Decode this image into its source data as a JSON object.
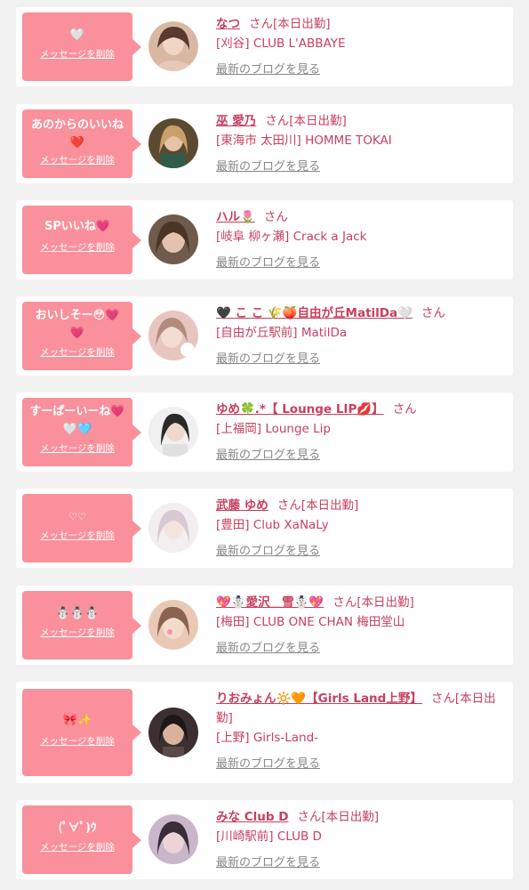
{
  "delete_label": "メッセージを削除",
  "blog_label": "最新のブログを見る",
  "san_suffix": "さん",
  "accent_color": "#f9909b",
  "name_color": "#c83f5e",
  "cards": [
    {
      "message": "🤍",
      "name": "なつ",
      "suffix": "さん[本日出勤]",
      "shop": "[刈谷] CLUB L'ABBAYE",
      "avatar_colors": [
        "#d9b8a3",
        "#5a3a2e"
      ]
    },
    {
      "message": "あのからのいいね\n❤️",
      "name": "巫 愛乃",
      "suffix": "さん[本日出勤]",
      "shop": "[東海市 太田川] HOMME TOKAI",
      "avatar_colors": [
        "#5b4a32",
        "#caa06a"
      ]
    },
    {
      "message": "SPいいね💗",
      "name": "ハル🌷",
      "suffix": "さん",
      "shop": "[岐阜 柳ヶ瀬] Crack a Jack",
      "avatar_colors": [
        "#6f5a4c",
        "#e3c3b0"
      ]
    },
    {
      "message": "おいしそー😳💗\n💗",
      "name": "🖤 こ こ 🌾🍑自由が丘MatilDa🤍",
      "suffix": "さん",
      "shop": "[自由が丘駅前] MatilDa",
      "avatar_colors": [
        "#e8c5bf",
        "#b28b7c"
      ]
    },
    {
      "message": "すーぱーいーね💗\n🤍🩵",
      "name": "ゆめ🍀.*【 Lounge LIP💋】",
      "suffix": "さん",
      "shop": "[上福岡] Lounge Lip",
      "avatar_colors": [
        "#f0f0f0",
        "#2a2a2a"
      ]
    },
    {
      "message": "♡♡",
      "name": "武藤 ゆめ",
      "suffix": "さん[本日出勤]",
      "shop": "[豊田] Club XaNaLy",
      "avatar_colors": [
        "#f3eef0",
        "#d8c9d4"
      ]
    },
    {
      "message": "☃️☃️☃️",
      "name": "💖☃️愛沢＿雪☃️💖",
      "suffix": "さん[本日出勤]",
      "shop": "[梅田] CLUB ONE CHAN 梅田堂山",
      "avatar_colors": [
        "#e9c9b6",
        "#8a6450"
      ]
    },
    {
      "message": "🎀✨",
      "name": "りおみょん🔆🧡【Girls Land上野】",
      "suffix": "さん[本日出勤]",
      "shop": "[上野] Girls-Land-",
      "avatar_colors": [
        "#3b2f2f",
        "#d8b29c"
      ]
    },
    {
      "message": "(ﾟ∀ﾟ)ｳ",
      "name": "みな Club D",
      "suffix": "さん[本日出勤]",
      "shop": "[川崎駅前] CLUB D",
      "avatar_colors": [
        "#c9b6c9",
        "#3a2d3a"
      ]
    }
  ]
}
